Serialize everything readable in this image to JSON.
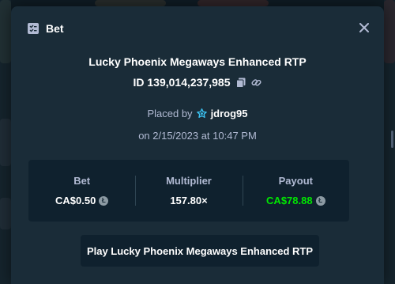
{
  "modal": {
    "title": "Bet",
    "icons": {
      "title_icon": "bet-ticket-icon",
      "close": "close-icon",
      "copy": "copy-icon",
      "link": "link-icon",
      "user": "star-badge-icon",
      "currency": "coin-icon"
    },
    "game_name": "Lucky Phoenix Megaways Enhanced RTP",
    "bet_id": "ID 139,014,237,985",
    "placed_by_label": "Placed by",
    "username": "jdrog95",
    "placed_on": "on 2/15/2023 at 10:47 PM",
    "stats": {
      "bet_label": "Bet",
      "bet_value": "CA$0.50",
      "multiplier_label": "Multiplier",
      "multiplier_value": "157.80×",
      "payout_label": "Payout",
      "payout_value": "CA$78.88"
    },
    "play_button": "Play Lucky Phoenix Megaways Enhanced RTP"
  },
  "colors": {
    "modal_bg": "#1a2c38",
    "panel_bg": "#0f212e",
    "muted_text": "#b1bad3",
    "payout_green": "#00e701",
    "user_badge": "#3bc1f0"
  }
}
